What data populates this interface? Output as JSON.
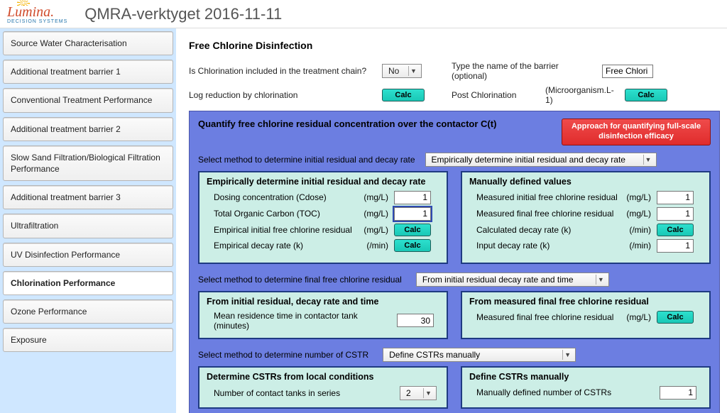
{
  "header": {
    "brand": "Lumina.",
    "brand_sub": "DECISION SYSTEMS",
    "title": "QMRA-verktyget 2016-11-11"
  },
  "sidebar": {
    "items": [
      {
        "label": "Source Water Characterisation"
      },
      {
        "label": "Additional treatment barrier 1"
      },
      {
        "label": "Conventional Treatment Performance"
      },
      {
        "label": "Additional treatment barrier 2"
      },
      {
        "label": "Slow Sand Filtration/Biological Filtration Performance"
      },
      {
        "label": "Additional treatment barrier 3"
      },
      {
        "label": "Ultrafiltration"
      },
      {
        "label": "UV Disinfection Performance"
      },
      {
        "label": "Chlorination Performance"
      },
      {
        "label": "Ozone Performance"
      },
      {
        "label": "Exposure"
      }
    ],
    "active_index": 8
  },
  "page": {
    "title": "Free Chlorine Disinfection"
  },
  "top": {
    "is_chlor_label": "Is Chlorination included in the treatment chain?",
    "is_chlor_value": "No",
    "log_red_label": "Log reduction by chlorination",
    "calc": "Calc",
    "barrier_name_label": "Type the name of the barrier (optional)",
    "barrier_name_value": "Free Chlori",
    "post_label": "Post Chlorination",
    "post_unit": "(Microorganism.L-1)"
  },
  "panel": {
    "title": "Quantify free chlorine residual concentration over the contactor C(t)",
    "approach": "Approach for quantifying full-scale disinfection efficacy",
    "method1_label": "Select method to determine initial residual and decay rate",
    "method1_value": "Empirically determine initial residual and decay rate",
    "emp": {
      "title": "Empirically determine initial residual and decay rate",
      "dose_label": "Dosing concentration (Cdose)",
      "dose_unit": "(mg/L)",
      "dose_val": "1",
      "toc_label": "Total Organic Carbon (TOC)",
      "toc_unit": "(mg/L)",
      "toc_val": "1",
      "emp_init_label": "Empirical initial free chlorine residual",
      "emp_init_unit": "(mg/L)",
      "emp_k_label": "Empirical decay rate (k)",
      "emp_k_unit": "(/min)"
    },
    "man": {
      "title": "Manually defined values",
      "m_init_label": "Measured initial free chlorine residual",
      "m_init_unit": "(mg/L)",
      "m_init_val": "1",
      "m_fin_label": "Measured final free chlorine residual",
      "m_fin_unit": "(mg/L)",
      "m_fin_val": "1",
      "calc_k_label": "Calculated decay rate (k)",
      "calc_k_unit": "(/min)",
      "input_k_label": "Input decay rate (k)",
      "input_k_unit": "(/min)",
      "input_k_val": "1"
    },
    "method2_label": "Select method to determine final free chlorine residual",
    "method2_value": "From initial residual decay rate and time",
    "from_init": {
      "title": "From initial residual, decay rate and time",
      "mrt_label": "Mean residence time in contactor tank (minutes)",
      "mrt_val": "30"
    },
    "from_meas": {
      "title": "From measured final free chlorine residual",
      "m_fin2_label": "Measured final free chlorine residual",
      "m_fin2_unit": "(mg/L)"
    },
    "method3_label": "Select method to determine number of CSTR",
    "method3_value": "Define CSTRs manually",
    "cstr_local": {
      "title": "Determine CSTRs from local conditions",
      "ntanks_label": "Number of contact tanks in series",
      "ntanks_val": "2"
    },
    "cstr_man": {
      "title": "Define CSTRs manually",
      "mdef_label": "Manually defined number of CSTRs",
      "mdef_val": "1"
    }
  }
}
